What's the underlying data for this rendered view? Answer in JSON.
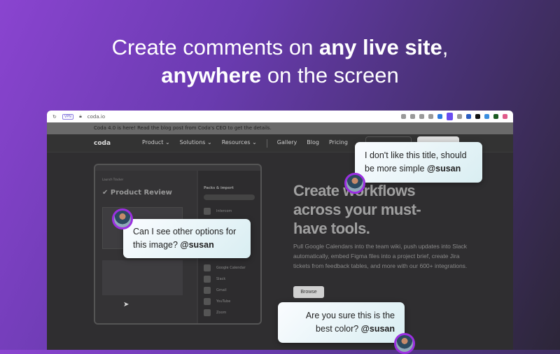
{
  "headline": {
    "line1_pre": "Create comments on ",
    "line1_bold": "any live site",
    "line1_post": ",",
    "line2_bold": "anywhere",
    "line2_post": " on the screen"
  },
  "browser": {
    "url": "coda.io",
    "vpn_label": "VPN"
  },
  "site": {
    "banner": "Coda 4.0 is here! Read the blog post from Coda's CEO to get the details.",
    "logo": "coda",
    "nav": [
      "Product ⌄",
      "Solutions ⌄",
      "Resources ⌄",
      "Gallery",
      "Blog",
      "Pricing"
    ],
    "hero_title": [
      "Create workflows",
      "across your must-",
      "have tools."
    ],
    "hero_desc": "Pull Google Calendars into the team wiki, push updates into Slack automatically, embed Figma files into a project brief, create Jira tickets from feedback tables, and more with our 600+ integrations.",
    "browse_label": "Browse",
    "app": {
      "breadcrumb": "Launch Tracker",
      "title": "Product Review",
      "panel_title": "Packs & import",
      "packs": [
        "Intercom",
        "Google Calendar",
        "Slack",
        "Gmail",
        "YouTube",
        "Zoom"
      ]
    }
  },
  "comments": [
    {
      "text": "I don't like this title, should be more simple ",
      "mention": "@susan"
    },
    {
      "text": "Can I see other options for this image? ",
      "mention": "@susan"
    },
    {
      "text": "Are you sure this is the best color? ",
      "mention": "@susan"
    }
  ]
}
